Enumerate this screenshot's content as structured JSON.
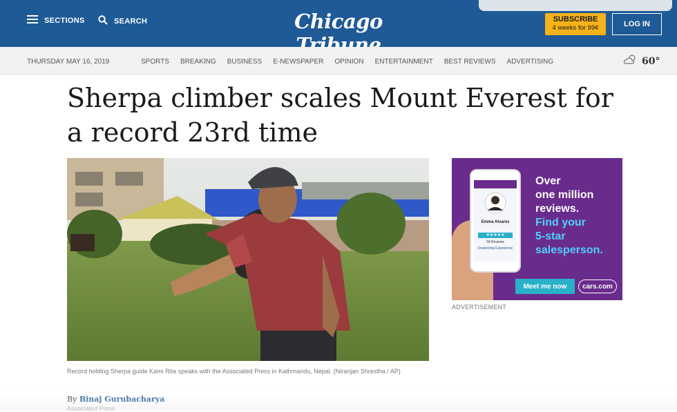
{
  "header": {
    "sections_label": "SECTIONS",
    "search_label": "SEARCH",
    "logo_text": "Chicago Tribune",
    "subscribe_line1": "SUBSCRIBE",
    "subscribe_line2": "4 weeks for 99¢",
    "login_label": "LOG IN"
  },
  "subnav": {
    "date": "THURSDAY MAY 16, 2019",
    "items": [
      "SPORTS",
      "BREAKING",
      "BUSINESS",
      "E-NEWSPAPER",
      "OPINION",
      "ENTERTAINMENT",
      "BEST REVIEWS",
      "ADVERTISING"
    ],
    "temperature": "60°",
    "weather_icon": "partly-cloudy-icon"
  },
  "article": {
    "headline": "Sherpa climber scales Mount Everest for a record 23rd time",
    "caption": "Record holding Sherpa guide Kami Rita speaks with the Associated Press in Kathmandu, Nepal.  (Niranjan Shrestha / AP)",
    "byline_prefix": "By",
    "author": "Binaj Gurubacharya",
    "affiliation": "Associated Press"
  },
  "ad": {
    "line1": "Over",
    "line2": "one million",
    "line3": "reviews.",
    "line4": "Find your",
    "line5": "5-star",
    "line6": "salesperson.",
    "cta": "Meet me now",
    "brand": "cars.com",
    "profile_name": "Emma Alvarez",
    "profile_reviews": "59 Reviews",
    "profile_exp": "Dealership Experience",
    "label": "ADVERTISEMENT"
  },
  "colors": {
    "brand_blue": "#1e5a96",
    "subscribe_yellow": "#f5b21a",
    "ad_purple": "#6a2c8c",
    "ad_cyan": "#4fd0ff"
  }
}
